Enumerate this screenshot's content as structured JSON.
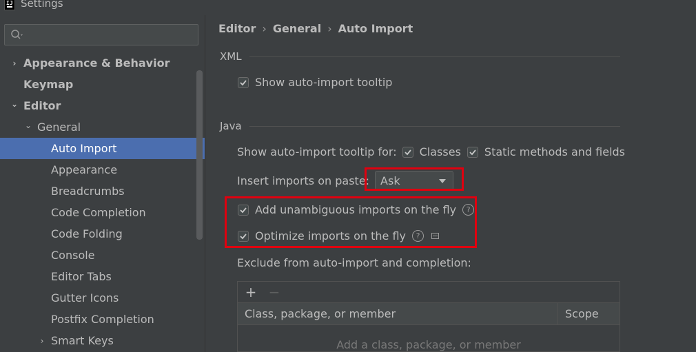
{
  "window": {
    "title": "Settings",
    "icon": "intellij-app-icon"
  },
  "sidebar": {
    "search": {
      "value": "",
      "placeholder": "",
      "icon": "search-icon"
    },
    "items": [
      {
        "label": "Appearance & Behavior",
        "arrow": "›",
        "bold": true
      },
      {
        "label": "Keymap",
        "bold": true
      },
      {
        "label": "Editor",
        "arrow": "⌄",
        "bold": true
      },
      {
        "label": "General",
        "arrow": "⌄"
      },
      {
        "label": "Auto Import",
        "selected": true
      },
      {
        "label": "Appearance"
      },
      {
        "label": "Breadcrumbs"
      },
      {
        "label": "Code Completion"
      },
      {
        "label": "Code Folding"
      },
      {
        "label": "Console"
      },
      {
        "label": "Editor Tabs"
      },
      {
        "label": "Gutter Icons"
      },
      {
        "label": "Postfix Completion"
      },
      {
        "label": "Smart Keys",
        "arrow": "›"
      }
    ]
  },
  "breadcrumb": [
    "Editor",
    "General",
    "Auto Import"
  ],
  "breadcrumb_separator": "›",
  "xml": {
    "section_title": "XML",
    "show_tooltip": {
      "label": "Show auto-import tooltip",
      "checked": true
    }
  },
  "java": {
    "section_title": "Java",
    "tooltip_for_label": "Show auto-import tooltip for:",
    "classes": {
      "label": "Classes",
      "checked": true
    },
    "static_methods": {
      "label": "Static methods and fields",
      "checked": true
    },
    "insert_on_paste_label": "Insert imports on paste:",
    "insert_on_paste_value": "Ask",
    "add_unambiguous": {
      "label": "Add unambiguous imports on the fly",
      "checked": true
    },
    "optimize_imports": {
      "label": "Optimize imports on the fly",
      "checked": true
    },
    "help_glyph": "?",
    "exclude_label": "Exclude from auto-import and completion:",
    "table": {
      "add_button": "+",
      "remove_button": "−",
      "columns": [
        "Class, package, or member",
        "Scope"
      ],
      "empty_text": "Add a class, package, or member"
    }
  },
  "colors": {
    "selection": "#4b6eaf",
    "highlight": "#e0000f",
    "background": "#3c3f41"
  }
}
